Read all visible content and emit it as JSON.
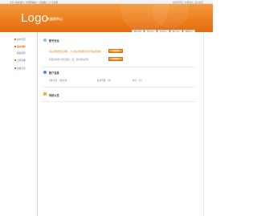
{
  "topbar": {
    "left_text": "首页 | 联系我们 | 付费网站推广 | 流量推广 | 广告联盟",
    "right_text": "欢迎您登录 | 注册会员 | 设为首页"
  },
  "header": {
    "logo": "Logo",
    "subtitle": "大会员中心"
  },
  "nav": {
    "tabs": [
      "网站首页",
      "站长中心",
      "会员中心",
      "推广中心",
      "帮助中心"
    ]
  },
  "sidebar": {
    "items": [
      {
        "label": "用户首页"
      },
      {
        "label": "基本资料"
      },
      {
        "label": "修改密码"
      },
      {
        "label": "上传头像"
      },
      {
        "label": "兑换记录"
      }
    ]
  },
  "main": {
    "account": {
      "title": "账号安全",
      "row1": "请完善您的会员资料，为了保证您的账户安全请完善资料",
      "row1_button": "完善资料",
      "row2": "您目前的账户密码强度：低，建议修改密码",
      "row2_button": "修改密码"
    },
    "stats": {
      "title": "账户信息",
      "items": [
        {
          "label": "当前主页：",
          "value": "0篇文章"
        },
        {
          "label": "总访问量：",
          "value": "0次"
        },
        {
          "label": "积分：",
          "value": "0分"
        }
      ]
    },
    "notice": {
      "title": "系统公告"
    }
  },
  "colors": {
    "accent": "#ee7f1e",
    "warning": "#e06f16"
  }
}
